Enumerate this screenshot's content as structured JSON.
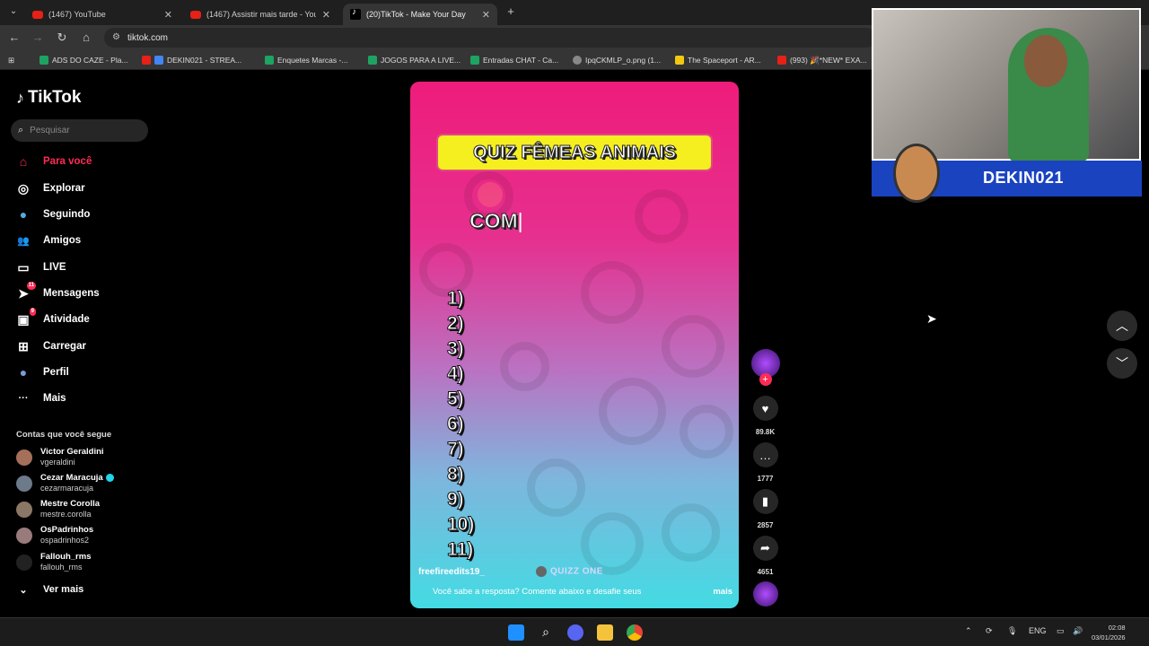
{
  "browser": {
    "tabs": [
      {
        "title": "(1467) YouTube",
        "close": "✕"
      },
      {
        "title": "(1467) Assistir mais tarde - You",
        "close": "✕"
      },
      {
        "title": "(20)TikTok - Make Your Day",
        "close": "✕"
      }
    ],
    "new_tab": "+",
    "url": "tiktok.com",
    "bookmarks": [
      {
        "label": "ADS DO CAZE - Pla...",
        "color": "#1ea362"
      },
      {
        "label": "DEKIN021 - STREA...",
        "color": "#4285f4"
      },
      {
        "label": "Enquetes Marcas -...",
        "color": "#1ea362"
      },
      {
        "label": "JOGOS PARA A LIVE...",
        "color": "#1ea362"
      },
      {
        "label": "Entradas CHAT - Ca...",
        "color": "#1ea362"
      },
      {
        "label": "IpqCKMLP_o.png (1...",
        "color": "#888888"
      },
      {
        "label": "The Spaceport - AR...",
        "color": "#f2c811"
      },
      {
        "label": "(993) 🎉*NEW* EXA...",
        "color": "#e62117"
      }
    ]
  },
  "sidebar": {
    "logo": "TikTok",
    "search_placeholder": "Pesquisar",
    "nav": [
      {
        "label": "Para você",
        "icon": "home-icon",
        "glyph": "⌂"
      },
      {
        "label": "Explorar",
        "icon": "compass-icon",
        "glyph": "◎"
      },
      {
        "label": "Seguindo",
        "icon": "following-icon",
        "glyph": "●"
      },
      {
        "label": "Amigos",
        "icon": "friends-icon",
        "glyph": "👥"
      },
      {
        "label": "LIVE",
        "icon": "live-icon",
        "glyph": "▭"
      },
      {
        "label": "Mensagens",
        "icon": "messages-icon",
        "glyph": "➤",
        "badge": "11"
      },
      {
        "label": "Atividade",
        "icon": "activity-icon",
        "glyph": "▣",
        "badge": "9"
      },
      {
        "label": "Carregar",
        "icon": "upload-icon",
        "glyph": "⊞"
      },
      {
        "label": "Perfil",
        "icon": "profile-icon",
        "glyph": "●"
      },
      {
        "label": "Mais",
        "icon": "more-icon",
        "glyph": "···"
      }
    ],
    "following_title": "Contas que você segue",
    "accounts": [
      {
        "name": "Victor Geraldini",
        "user": "vgeraldini",
        "verified": false
      },
      {
        "name": "Cezar Maracuja",
        "user": "cezarmaracuja",
        "verified": true
      },
      {
        "name": "Mestre Corolla",
        "user": "mestre.corolla",
        "verified": false
      },
      {
        "name": "OsPadrinhos",
        "user": "ospadrinhos2",
        "verified": false
      },
      {
        "name": "Fallouh_rms",
        "user": "fallouh_rms",
        "verified": false
      }
    ],
    "see_more": "Ver mais"
  },
  "video": {
    "title": "QUIZ FÊMEAS ANIMAIS",
    "current_word": "COM",
    "numbers": [
      "1)",
      "2)",
      "3)",
      "4)",
      "5)",
      "6)",
      "7)",
      "8)",
      "9)",
      "10)",
      "11)"
    ],
    "author": "freefireedits19_",
    "watermark": "QUIZZ ONE",
    "caption": "Você sabe a resposta? Comente abaixo e desafie seus",
    "more": "mais"
  },
  "actions": {
    "likes": "89.8K",
    "comments": "1777",
    "saves": "2857",
    "shares": "4651"
  },
  "overlay": {
    "handle": "DEKIN021"
  },
  "taskbar": {
    "lang": "ENG",
    "time": "02:08",
    "date": "03/01/2026"
  }
}
